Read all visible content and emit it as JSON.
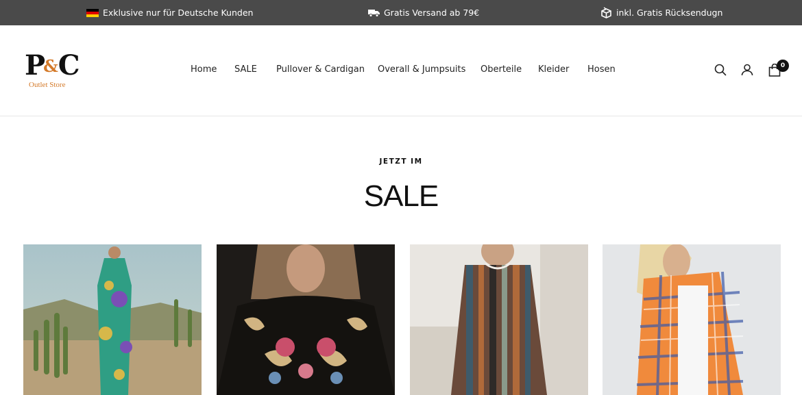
{
  "announcement": {
    "items": [
      {
        "icon": "germany-flag-icon",
        "text": "Exklusive nur für Deutsche Kunden"
      },
      {
        "icon": "truck-icon",
        "text": "Gratis Versand ab 79€"
      },
      {
        "icon": "return-box-icon",
        "text": "inkl. Gratis Rücksendugn"
      }
    ]
  },
  "brand": {
    "logo_mark": "P&C",
    "logo_sub": "Outlet Store"
  },
  "nav": {
    "items": [
      "Home",
      "SALE",
      "Pullover & Cardigan",
      "Overall & Jumpsuits",
      "Oberteile",
      "Kleider",
      "Hosen"
    ]
  },
  "header_icons": {
    "search": "search-icon",
    "account": "user-icon",
    "cart": "shopping-bag-icon",
    "cart_count": "0"
  },
  "hero": {
    "kicker": "JETZT IM",
    "title": "SALE"
  },
  "products": [
    {
      "image": "floral-jumpsuit-desert"
    },
    {
      "image": "black-floral-blouse"
    },
    {
      "image": "striped-dress"
    },
    {
      "image": "plaid-shirt-orange"
    }
  ],
  "colors": {
    "announcement_bg": "#4a4a4a",
    "accent": "#d47a2a",
    "text": "#1c1c1c"
  }
}
